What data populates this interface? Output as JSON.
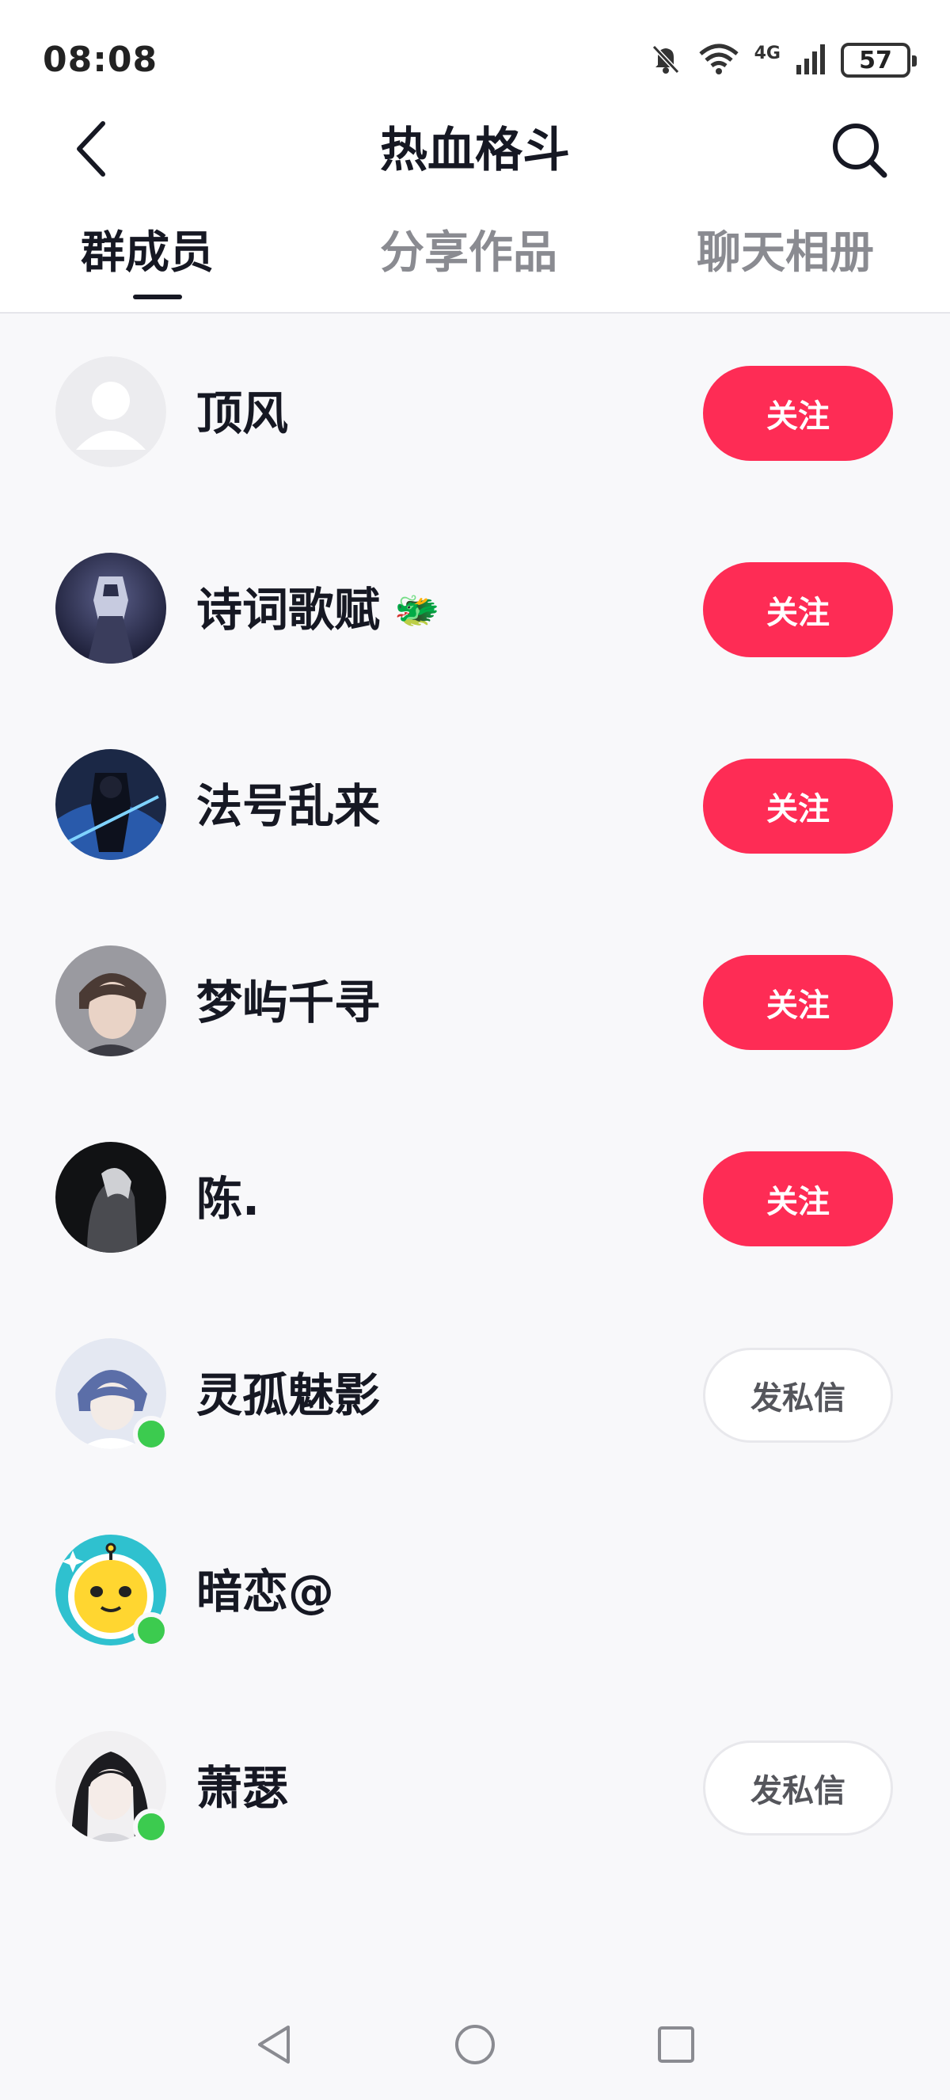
{
  "status_bar": {
    "time": "08:08",
    "network": "4G",
    "battery": "57"
  },
  "header": {
    "title": "热血格斗",
    "back_icon": "chevron-left-icon",
    "search_icon": "search-icon"
  },
  "tabs": [
    {
      "label": "群成员",
      "active": true
    },
    {
      "label": "分享作品",
      "active": false
    },
    {
      "label": "聊天相册",
      "active": false
    }
  ],
  "members": [
    {
      "name": "顶风",
      "action": "关注",
      "action_type": "follow",
      "online": false,
      "avatar": "default-avatar"
    },
    {
      "name": "诗词歌赋",
      "badge": "🐲",
      "action": "关注",
      "action_type": "follow",
      "online": false,
      "avatar": "armored-hero-avatar"
    },
    {
      "name": "法号乱来",
      "action": "关注",
      "action_type": "follow",
      "online": false,
      "avatar": "dark-warrior-avatar"
    },
    {
      "name": "梦屿千寻",
      "action": "关注",
      "action_type": "follow",
      "online": false,
      "avatar": "portrait-boy-avatar"
    },
    {
      "name": "陈.",
      "action": "关注",
      "action_type": "follow",
      "online": false,
      "avatar": "silhouette-avatar"
    },
    {
      "name": "灵孤魅影",
      "action": "发私信",
      "action_type": "message",
      "online": true,
      "avatar": "anime-boy-avatar"
    },
    {
      "name": "暗恋@",
      "action": "",
      "action_type": "none",
      "online": true,
      "avatar": "yellow-cartoon-avatar"
    },
    {
      "name": "萧瑟",
      "action": "发私信",
      "action_type": "message",
      "online": true,
      "avatar": "ink-anime-avatar"
    }
  ],
  "colors": {
    "accent": "#fe2c55",
    "online": "#3ccb4f",
    "text_primary": "#161823",
    "text_secondary": "#8a8b91",
    "background": "#f8f8fa"
  }
}
